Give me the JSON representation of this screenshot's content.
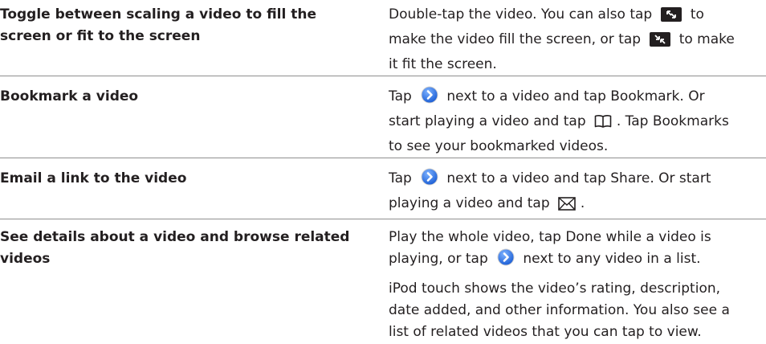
{
  "rows": [
    {
      "task": "Toggle between scaling a video to fill the screen or fit to the screen",
      "lines": [
        [
          {
            "t": "Double-tap the video. You can also tap "
          },
          {
            "icon": "fill-screen-icon"
          },
          {
            "t": " to"
          }
        ],
        [
          {
            "t": "make the video fill the screen, or tap "
          },
          {
            "icon": "fit-screen-icon"
          },
          {
            "t": " to make"
          }
        ],
        [
          {
            "t": "it fit the screen."
          }
        ]
      ]
    },
    {
      "task": "Bookmark a video",
      "lines": [
        [
          {
            "t": "Tap "
          },
          {
            "icon": "detail-disclosure-icon"
          },
          {
            "t": " next to a video and tap Bookmark. Or"
          }
        ],
        [
          {
            "t": "start playing a video and tap "
          },
          {
            "icon": "bookmarks-book-icon"
          },
          {
            "t": ". Tap Bookmarks"
          }
        ],
        [
          {
            "t": "to see your bookmarked videos."
          }
        ]
      ]
    },
    {
      "task": "Email a link to the video",
      "lines": [
        [
          {
            "t": "Tap "
          },
          {
            "icon": "detail-disclosure-icon"
          },
          {
            "t": " next to a video and tap Share. Or start"
          }
        ],
        [
          {
            "t": "playing a video and tap "
          },
          {
            "icon": "mail-envelope-icon"
          },
          {
            "t": "."
          }
        ]
      ]
    },
    {
      "task": "See details about a video and browse related videos",
      "lines": [
        [
          {
            "t": "Play the whole video, tap Done while a video is"
          }
        ],
        [
          {
            "t": "playing, or tap "
          },
          {
            "icon": "detail-disclosure-icon"
          },
          {
            "t": " next to any video in a list."
          }
        ]
      ],
      "extra_lines": [
        "iPod touch shows the video’s rating, description,",
        "date added, and other information. You also see a",
        "list of related videos that you can tap to view."
      ]
    }
  ]
}
